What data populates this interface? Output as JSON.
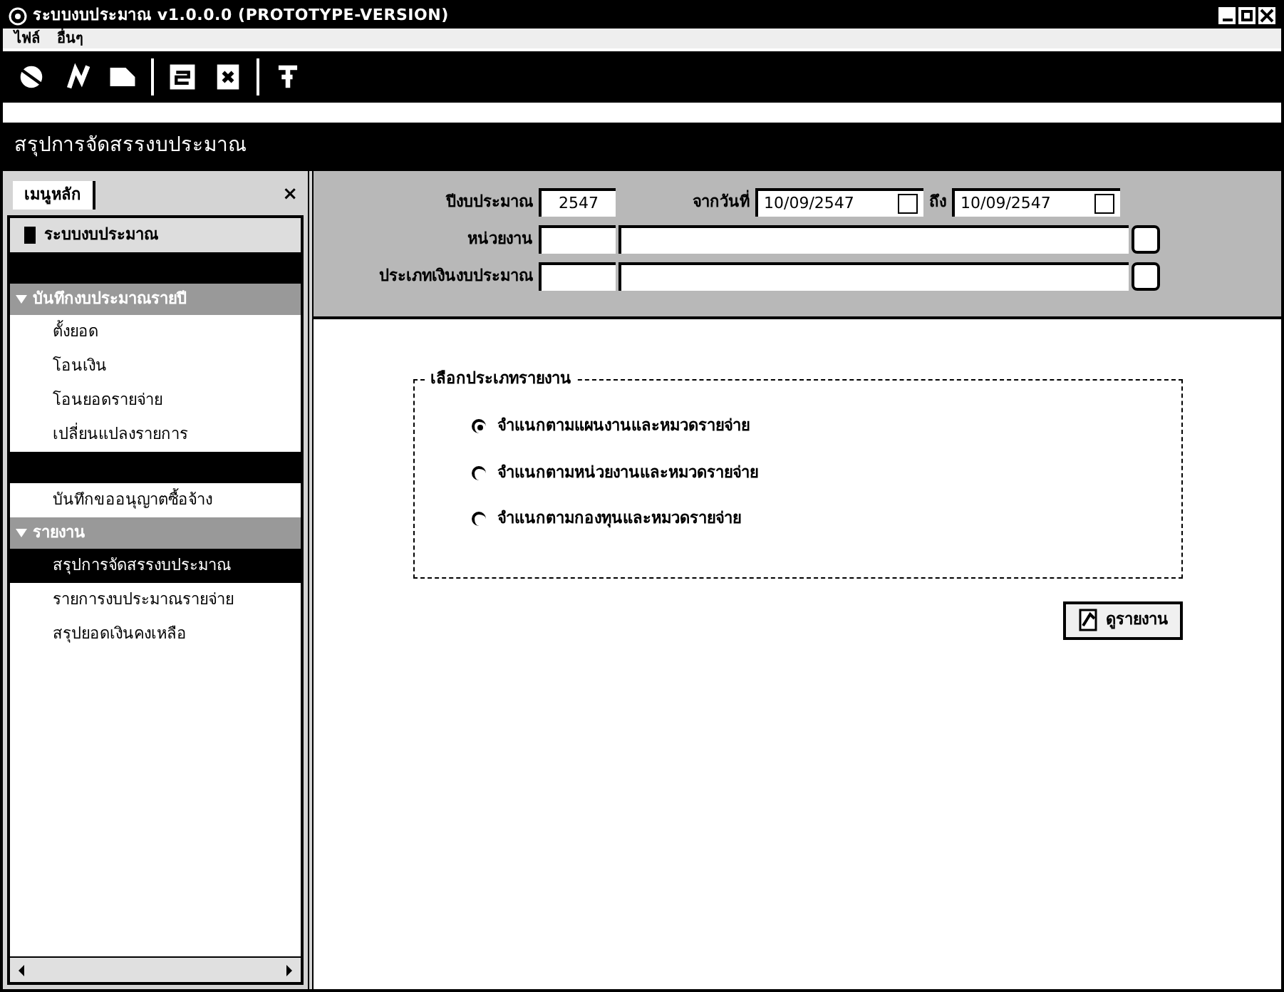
{
  "window": {
    "title": "ระบบงบประมาณ v1.0.0.0 (PROTOTYPE-VERSION)"
  },
  "menu": [
    "ไฟล์",
    "อื่นๆ"
  ],
  "toolbar": [
    {
      "kind": "button"
    },
    {
      "kind": "button"
    },
    {
      "kind": "button"
    },
    {
      "kind": "separator"
    },
    {
      "kind": "button"
    },
    {
      "kind": "button"
    },
    {
      "kind": "separator"
    },
    {
      "kind": "button"
    }
  ],
  "page_title": "สรุปการจัดสรรงบประมาณ",
  "sidebar": {
    "tab": "เมนูหลัก",
    "close": "×",
    "items": [
      {
        "kind": "root",
        "label": "ระบบงบประมาณ"
      },
      {
        "kind": "bar"
      },
      {
        "kind": "group",
        "label": "บันทึกงบประมาณรายปี",
        "expanded": true
      },
      {
        "kind": "item",
        "label": "ตั้งยอด",
        "selected": false
      },
      {
        "kind": "item",
        "label": "โอนเงิน",
        "selected": false
      },
      {
        "kind": "item",
        "label": "โอนยอดรายจ่าย",
        "selected": false
      },
      {
        "kind": "item",
        "label": "เปลี่ยนแปลงรายการ",
        "selected": false
      },
      {
        "kind": "bar"
      },
      {
        "kind": "item",
        "label": "บันทึกขออนุญาตซื้อจ้าง",
        "selected": false
      },
      {
        "kind": "group",
        "label": "รายงาน",
        "expanded": true
      },
      {
        "kind": "item",
        "label": "สรุปการจัดสรรงบประมาณ",
        "selected": true
      },
      {
        "kind": "item",
        "label": "รายการงบประมาณรายจ่าย",
        "selected": false
      },
      {
        "kind": "item",
        "label": "สรุปยอดเงินคงเหลือ",
        "selected": false
      }
    ]
  },
  "form": {
    "year_label": "ปีงบประมาณ",
    "year": "2547",
    "from_label": "จากวันที่",
    "from": "10/09/2547",
    "to_label": "ถึง",
    "to": "10/09/2547",
    "unit_label": "หน่วยงาน",
    "type_label": "ประเภทเงินงบประมาณ"
  },
  "report_group": {
    "title": "เลือกประเภทรายงาน",
    "options": [
      {
        "label": "จำแนกตามแผนงานและหมวดรายจ่าย",
        "selected": true
      },
      {
        "label": "จำแนกตามหน่วยงานและหมวดรายจ่าย",
        "selected": false
      },
      {
        "label": "จำแนกตามกองทุนและหมวดรายจ่าย",
        "selected": false
      }
    ]
  },
  "view_button": "ดูรายงาน"
}
